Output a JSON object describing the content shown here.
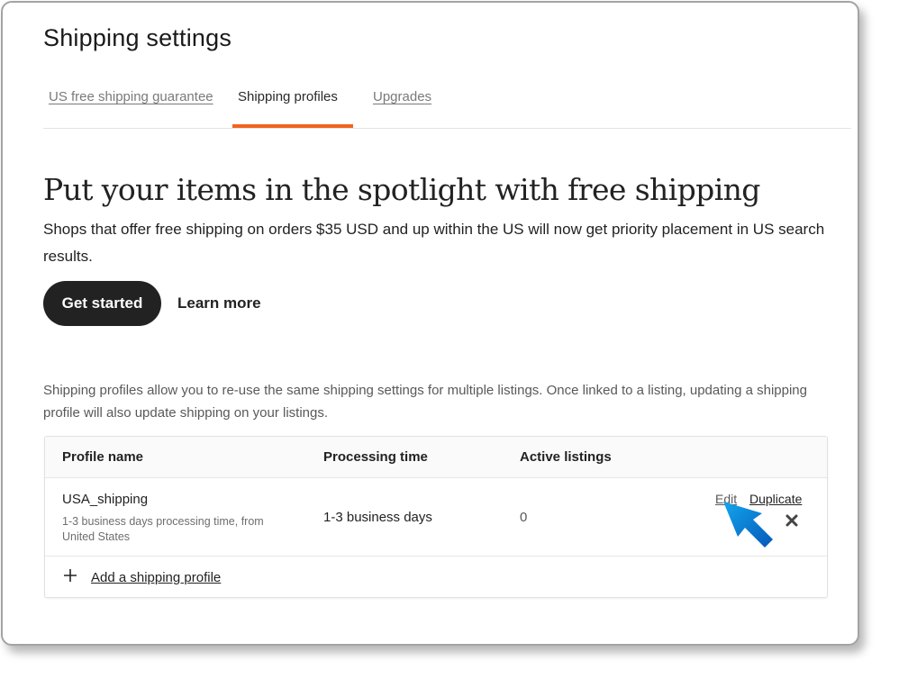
{
  "page": {
    "title": "Shipping settings"
  },
  "tabs": [
    {
      "label": "US free shipping guarantee",
      "active": false
    },
    {
      "label": "Shipping profiles",
      "active": true
    },
    {
      "label": "Upgrades",
      "active": false
    }
  ],
  "colors": {
    "accent": "#f1641e",
    "primary_button": "#222222",
    "cursor": "#0a8ee0"
  },
  "hero": {
    "title": "Put your items in the spotlight with free shipping",
    "text": "Shops that offer free shipping on orders $35 USD and up within the US will now get priority placement in US search results.",
    "primary_button": "Get started",
    "secondary_link": "Learn more"
  },
  "profiles": {
    "description": "Shipping profiles allow you to re-use the same shipping settings for multiple listings. Once linked to a listing, updating a shipping profile will also update shipping on your listings.",
    "columns": [
      "Profile name",
      "Processing time",
      "Active listings"
    ],
    "rows": [
      {
        "name": "USA_shipping",
        "subtitle": "1-3 business days processing time, from United States",
        "processing_time": "1-3 business days",
        "active_listings": "0",
        "actions": {
          "edit": "Edit",
          "duplicate": "Duplicate",
          "delete_icon": "close-x"
        }
      }
    ],
    "add_label": "Add a shipping profile",
    "add_icon": "plus"
  }
}
